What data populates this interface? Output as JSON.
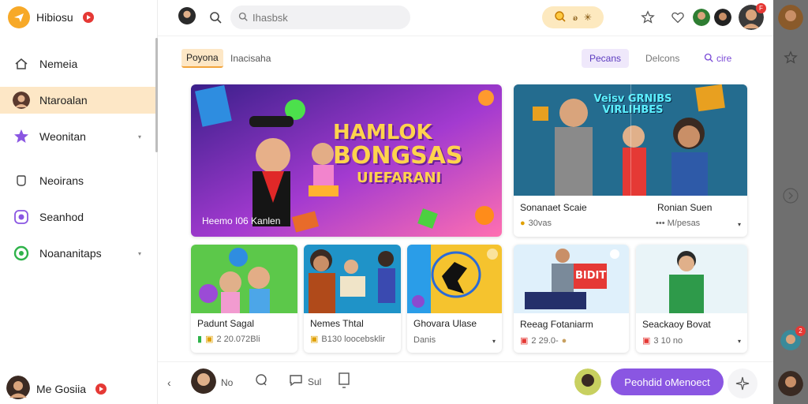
{
  "app": {
    "name": "Hibiosu"
  },
  "colors": {
    "accent": "#f7a928",
    "active_bg": "#fde7c6",
    "cta": "#8a56e2",
    "rail": "#6f6f6f"
  },
  "sidebar": {
    "items": [
      {
        "label": "Nemeia",
        "icon": "house-icon"
      },
      {
        "label": "Ntaroalan",
        "icon": "avatar-icon",
        "active": true
      },
      {
        "label": "Weonitan",
        "icon": "star-icon",
        "caret": true
      },
      {
        "label": "Neoirans",
        "icon": "hand-icon"
      },
      {
        "label": "Seanhod",
        "icon": "record-icon"
      },
      {
        "label": "Noananitaps",
        "icon": "circle-icon",
        "caret": true
      }
    ],
    "profile": {
      "name": "Me Gosiia"
    }
  },
  "topbar": {
    "search_placeholder": "Ihasbsk",
    "coins": {
      "icon": "search-coin-icon",
      "label": "ꭷ"
    },
    "notifications": "F"
  },
  "filters": {
    "left": [
      "Poyona",
      "Inacisaha"
    ],
    "right": [
      "Pecans",
      "Delcons",
      "cire"
    ]
  },
  "cards": {
    "hero": {
      "title_lines": [
        "HAMLOK",
        "BONGSAS",
        "UIEFARANI"
      ],
      "caption": "Heemo I06 Kanlen"
    },
    "top_right": [
      {
        "title": "Sonanaet Scaie",
        "meta": "30vas",
        "img_text": "Veisv GRNIBS VIRLIHBES"
      },
      {
        "title": "Ronian Suen",
        "meta": "••• M/pesas"
      }
    ],
    "small": [
      {
        "title": "Padunt Sagal",
        "meta": "2 20.072Bli"
      },
      {
        "title": "Nemes Thtal",
        "meta": "B130 loocebsklir"
      },
      {
        "title": "Ghovara Ulase",
        "meta": "Danis"
      },
      {
        "title": "Reeag Fotaniarm",
        "meta": "2 29.0-",
        "img_text": "BIDIT"
      },
      {
        "title": "Seackaoy Bovat",
        "meta": "3 10 no"
      }
    ]
  },
  "bottombar": {
    "items": [
      {
        "label": "No",
        "icon": "avatar-icon"
      },
      {
        "label": "",
        "icon": "comment-icon"
      },
      {
        "label": "Sul",
        "icon": "chat-icon"
      },
      {
        "label": "",
        "icon": "bookmark-icon"
      }
    ],
    "cta": "Peohdid oMenoect"
  }
}
